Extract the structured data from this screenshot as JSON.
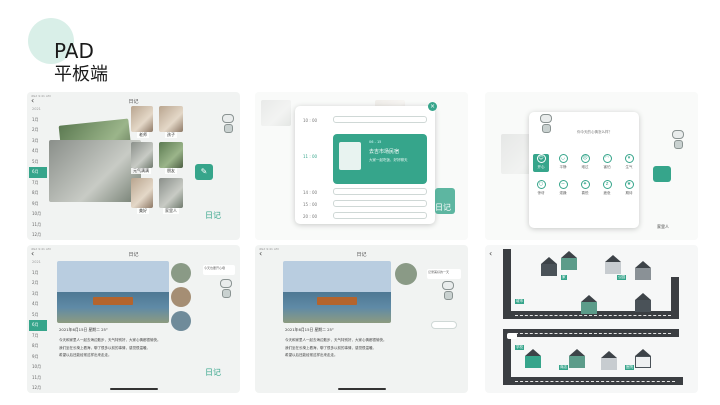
{
  "header": {
    "title": "PAD",
    "subtitle": "平板端"
  },
  "device": {
    "status": "iPad 9:41 AM",
    "nav_title": "日记",
    "back_icon": "chevron-left-icon"
  },
  "calendar": {
    "year": "2021",
    "months": [
      "1月",
      "2月",
      "3月",
      "4月",
      "5月",
      "6月",
      "7月",
      "8月",
      "9月",
      "10月",
      "11月",
      "12月"
    ],
    "active_month": "6月"
  },
  "screen1": {
    "photo_captions": [
      "老师",
      "孩子",
      "元气满满",
      "朋友",
      "美好",
      "家里人"
    ],
    "diary_label": "日记"
  },
  "screen2": {
    "times": [
      "10 : 00",
      "11 : 00",
      "14 : 00",
      "15 : 00",
      "20 : 00"
    ],
    "active_time": "11 : 00",
    "event_title": "去吉市场民宿",
    "event_date": "06 - 15",
    "event_detail": "大家一起吃饭、好好聊天",
    "diary_label": "日记"
  },
  "screen3": {
    "prompt": "你今天的心情怎么样？",
    "moods": [
      "开心",
      "平静",
      "难过",
      "害怕",
      "生气",
      "惊讶",
      "烦躁",
      "喜悦",
      "疲惫",
      "期待"
    ],
    "selected_mood": "开心",
    "right_caption": "家里人"
  },
  "screen4": {
    "entry_header": "2021年6月15日 星期二 25°",
    "entry_lines": [
      "今天和家里人一起去海边散步，天气特别好，大家心情都很愉快。",
      "我们坐在长椅上看海，聊了很多以前的事情，感觉很温暖。",
      "希望以后还能经常这样出来走走。"
    ],
    "diary_label": "日记",
    "bubble_text": "今天也要开心哦"
  },
  "screen5": {
    "entry_header": "2021年6月15日 星期二 25°",
    "bubble_text": "记录美好的一天"
  },
  "screen6": {
    "signs": [
      "城市",
      "家",
      "公园",
      "学校",
      "商店",
      "医院"
    ]
  },
  "colors": {
    "accent": "#36a58b",
    "blob": "#d9efe8",
    "road": "#3b3e42"
  }
}
